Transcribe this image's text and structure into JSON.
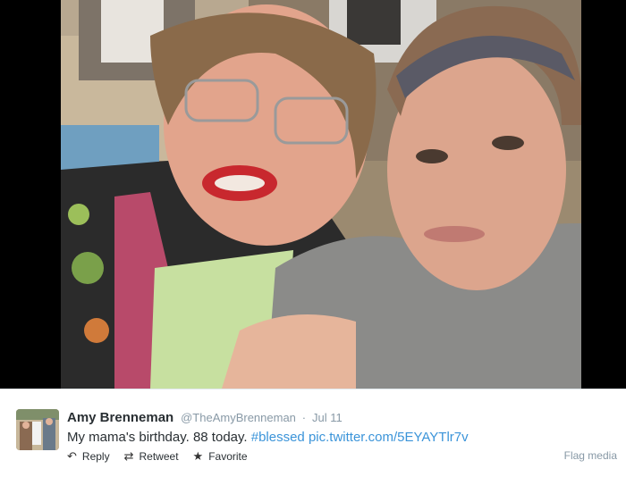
{
  "photo": {
    "description_icon": "selfie-photo"
  },
  "tweet": {
    "avatar_icon": "profile-avatar",
    "name": "Amy Brenneman",
    "handle": "@TheAmyBrenneman",
    "separator": "·",
    "date": "Jul 11",
    "text_plain": "My mama's birthday. 88 today.",
    "hashtag": "#blessed",
    "link": "pic.twitter.com/5EYAYTlr7v",
    "actions": {
      "reply": {
        "icon": "reply-icon",
        "label": "Reply"
      },
      "retweet": {
        "icon": "retweet-icon",
        "label": "Retweet"
      },
      "favorite": {
        "icon": "star-icon",
        "label": "Favorite"
      }
    },
    "flag_media": "Flag media"
  },
  "colors": {
    "link": "#3b94d9",
    "muted": "#8899a6",
    "text": "#292f33",
    "frame": "#000000"
  }
}
